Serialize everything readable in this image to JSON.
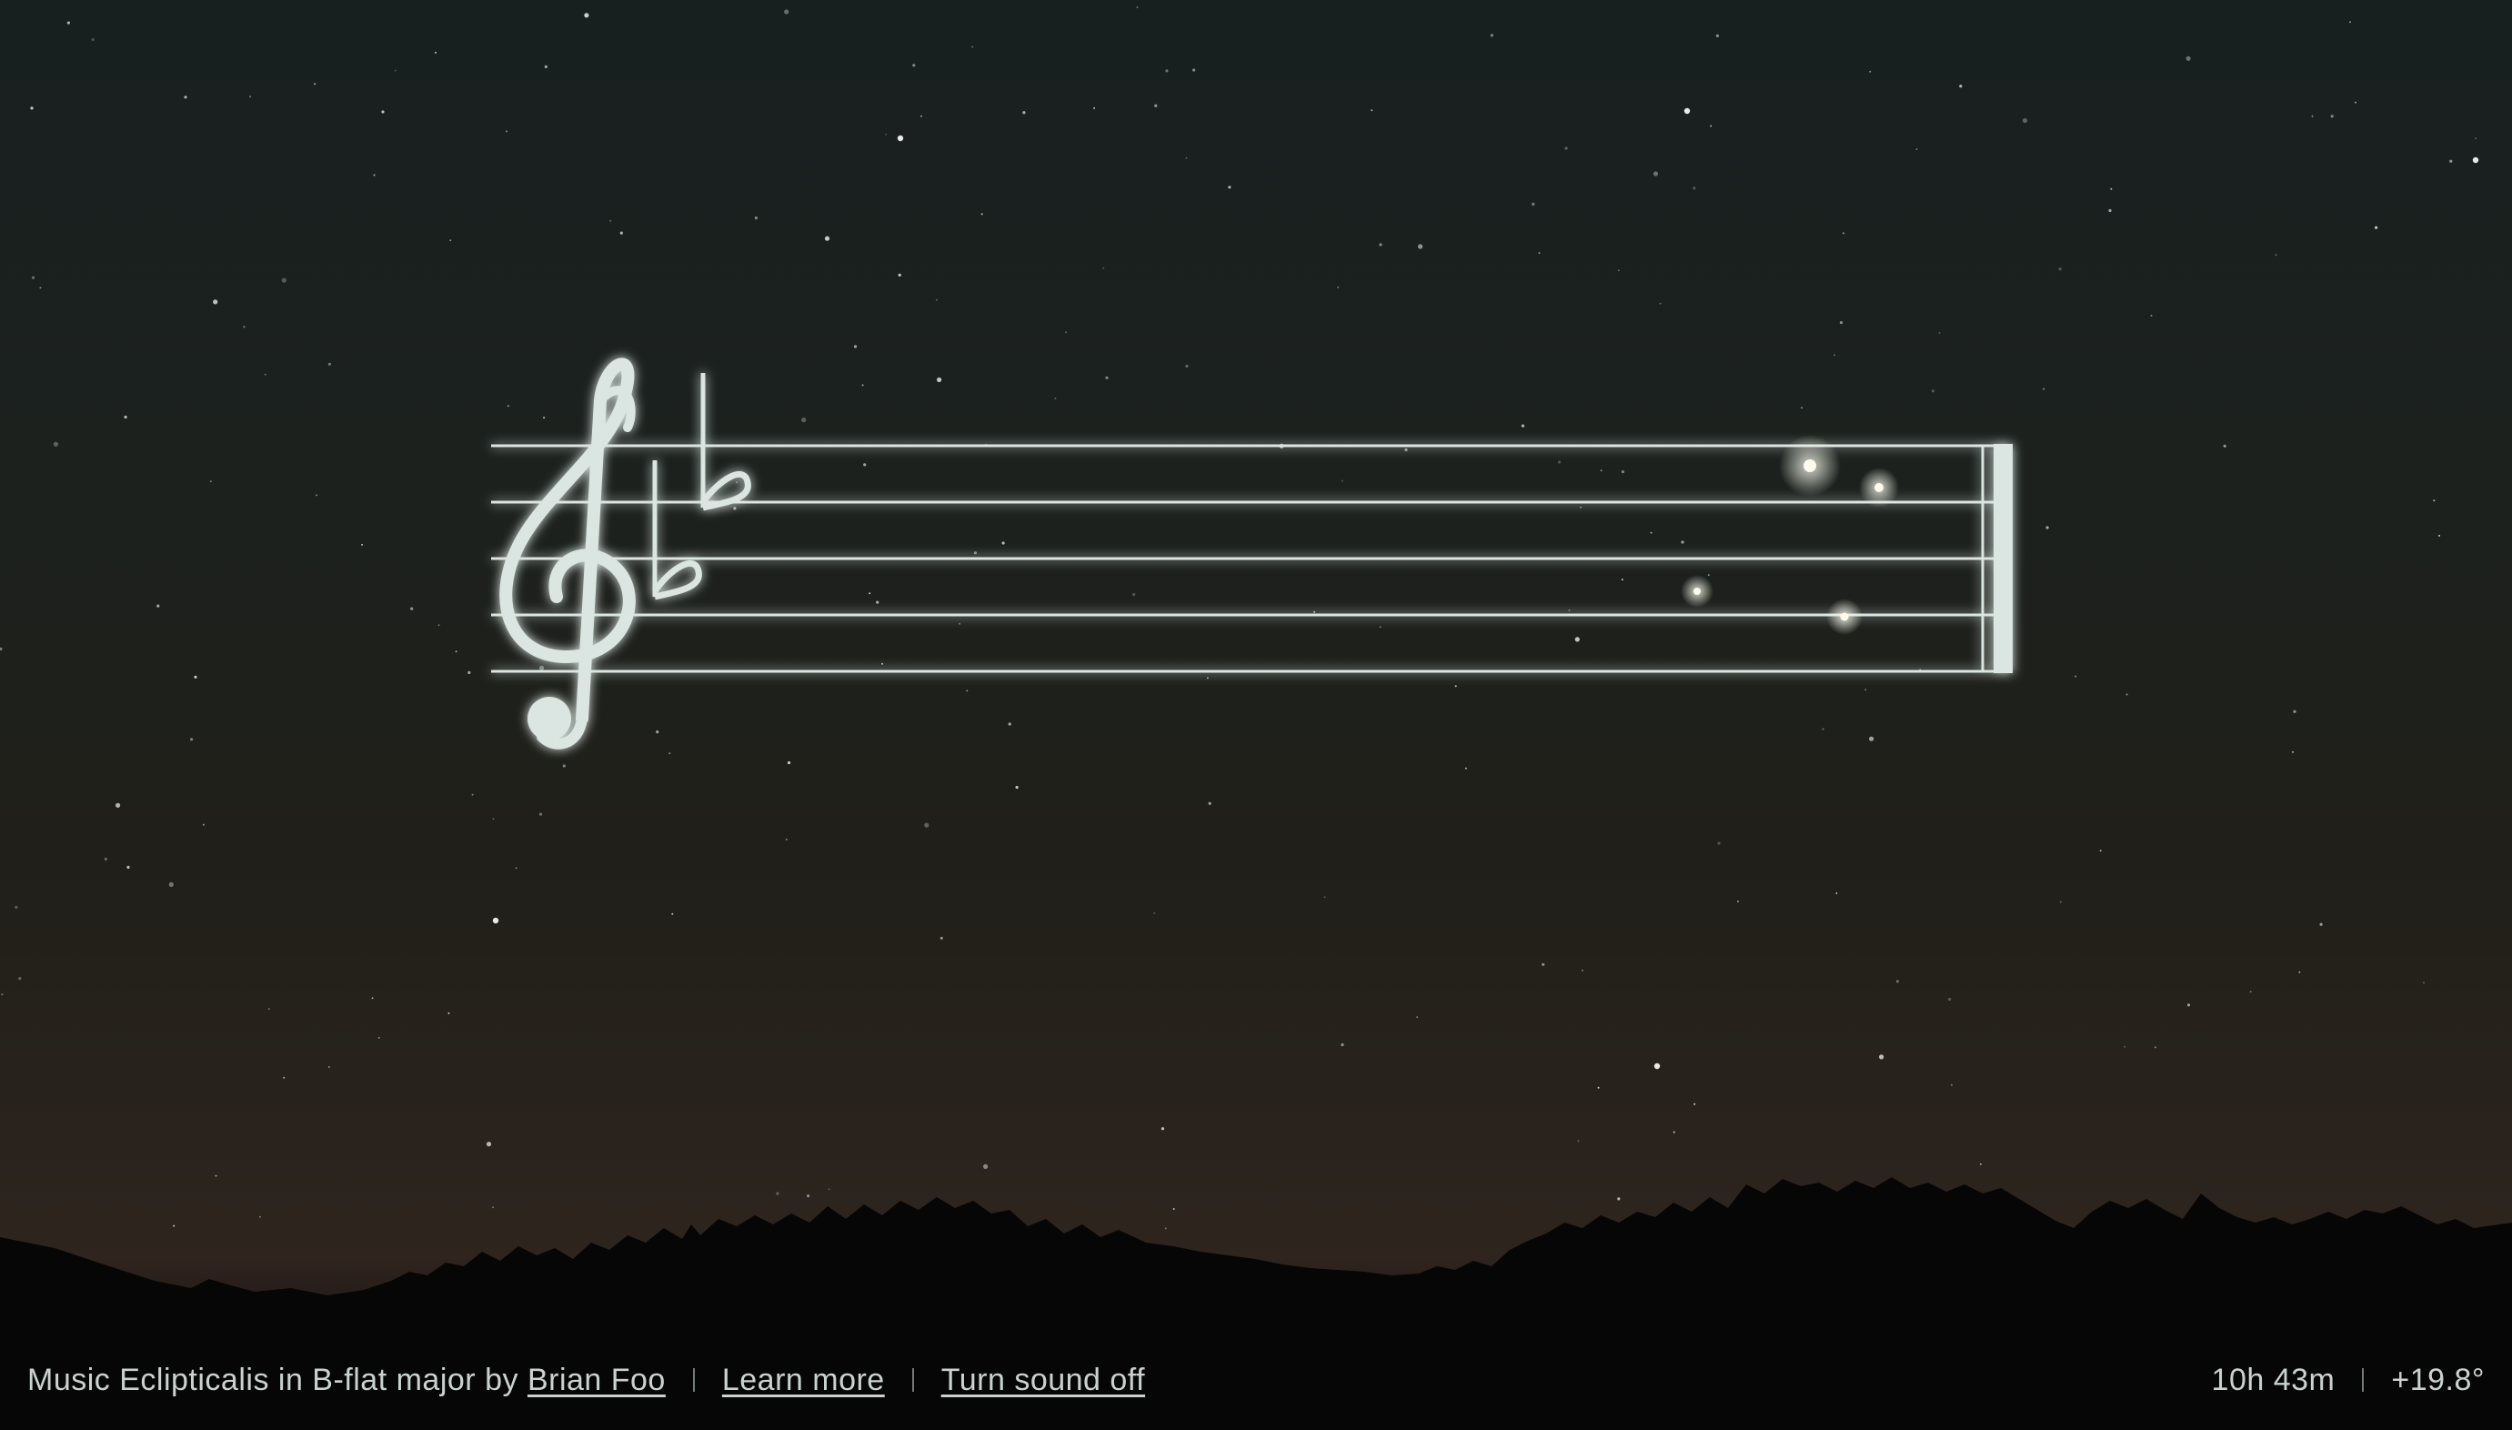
{
  "piece": {
    "title_prefix": "Music Eclipticalis in B-flat major by",
    "composer_link": "Brian Foo",
    "learn_more_link": "Learn more",
    "sound_toggle_link": "Turn sound off"
  },
  "coordinates": {
    "right_ascension": "10h 43m",
    "declination": "+19.8°"
  },
  "staff": {
    "clef": "treble",
    "key_signature": "B-flat major",
    "flats": 2,
    "line_count": 5,
    "color": "#dbe6e2"
  },
  "colors": {
    "sky_top": "#18201f",
    "horizon_glow": "#2f241e",
    "ground": "#060606",
    "text": "#c9d2cf"
  }
}
